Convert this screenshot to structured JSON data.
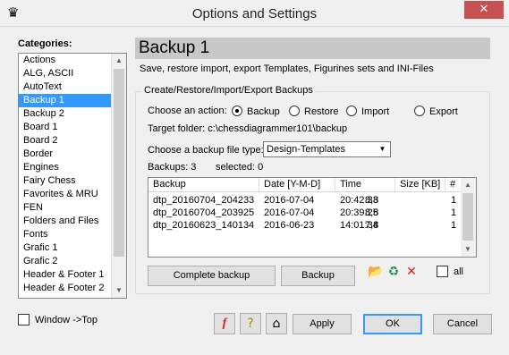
{
  "window": {
    "title": "Options and Settings",
    "app_icon": "chess-queen-icon",
    "close_label": "✕"
  },
  "categories": {
    "label": "Categories:",
    "items": [
      "Actions",
      "ALG, ASCII",
      "AutoText",
      "Backup 1",
      "Backup 2",
      "Board 1",
      "Board 2",
      "Border",
      "Engines",
      "Fairy Chess",
      "Favorites & MRU",
      "FEN",
      "Folders and Files",
      "Fonts",
      "Grafic 1",
      "Grafic 2",
      "Header & Footer 1",
      "Header & Footer 2"
    ],
    "selected": "Backup 1"
  },
  "window_top": {
    "label": "Window ->Top",
    "checked": false
  },
  "panel": {
    "title": "Backup 1",
    "subtitle": "Save, restore import, export Templates, Figurines sets and INI-Files",
    "group_title": "Create/Restore/Import/Export Backups",
    "action_label": "Choose an action:",
    "actions": [
      {
        "label": "Backup",
        "selected": true
      },
      {
        "label": "Restore",
        "selected": false
      },
      {
        "label": "Import",
        "selected": false
      },
      {
        "label": "Export",
        "selected": false
      }
    ],
    "target_folder": "Target folder:  c:\\chessdiagrammer101\\backup",
    "file_type_label": "Choose a backup file type:",
    "file_type_value": "Design-Templates",
    "backups_count": "Backups: 3",
    "selected_count": "selected: 0",
    "columns": [
      "Backup",
      "Date [Y-M-D]",
      "Time",
      "Size [KB]",
      "#"
    ],
    "rows": [
      [
        "dtp_20160704_204233",
        "2016-07-04",
        "20:42:33",
        "8,8",
        "1"
      ],
      [
        "dtp_20160704_203925",
        "2016-07-04",
        "20:39:25",
        "8,8",
        "1"
      ],
      [
        "dtp_20160623_140134",
        "2016-06-23",
        "14:01:34",
        "7,8",
        "1"
      ]
    ],
    "complete_backup_label": "Complete backup",
    "backup_label": "Backup",
    "all_label": "all"
  },
  "footer": {
    "apply_label": "Apply",
    "ok_label": "OK",
    "cancel_label": "Cancel"
  },
  "colors": {
    "selection": "#3399ff",
    "header_bar": "#c8c8c8",
    "close": "#c75050"
  }
}
